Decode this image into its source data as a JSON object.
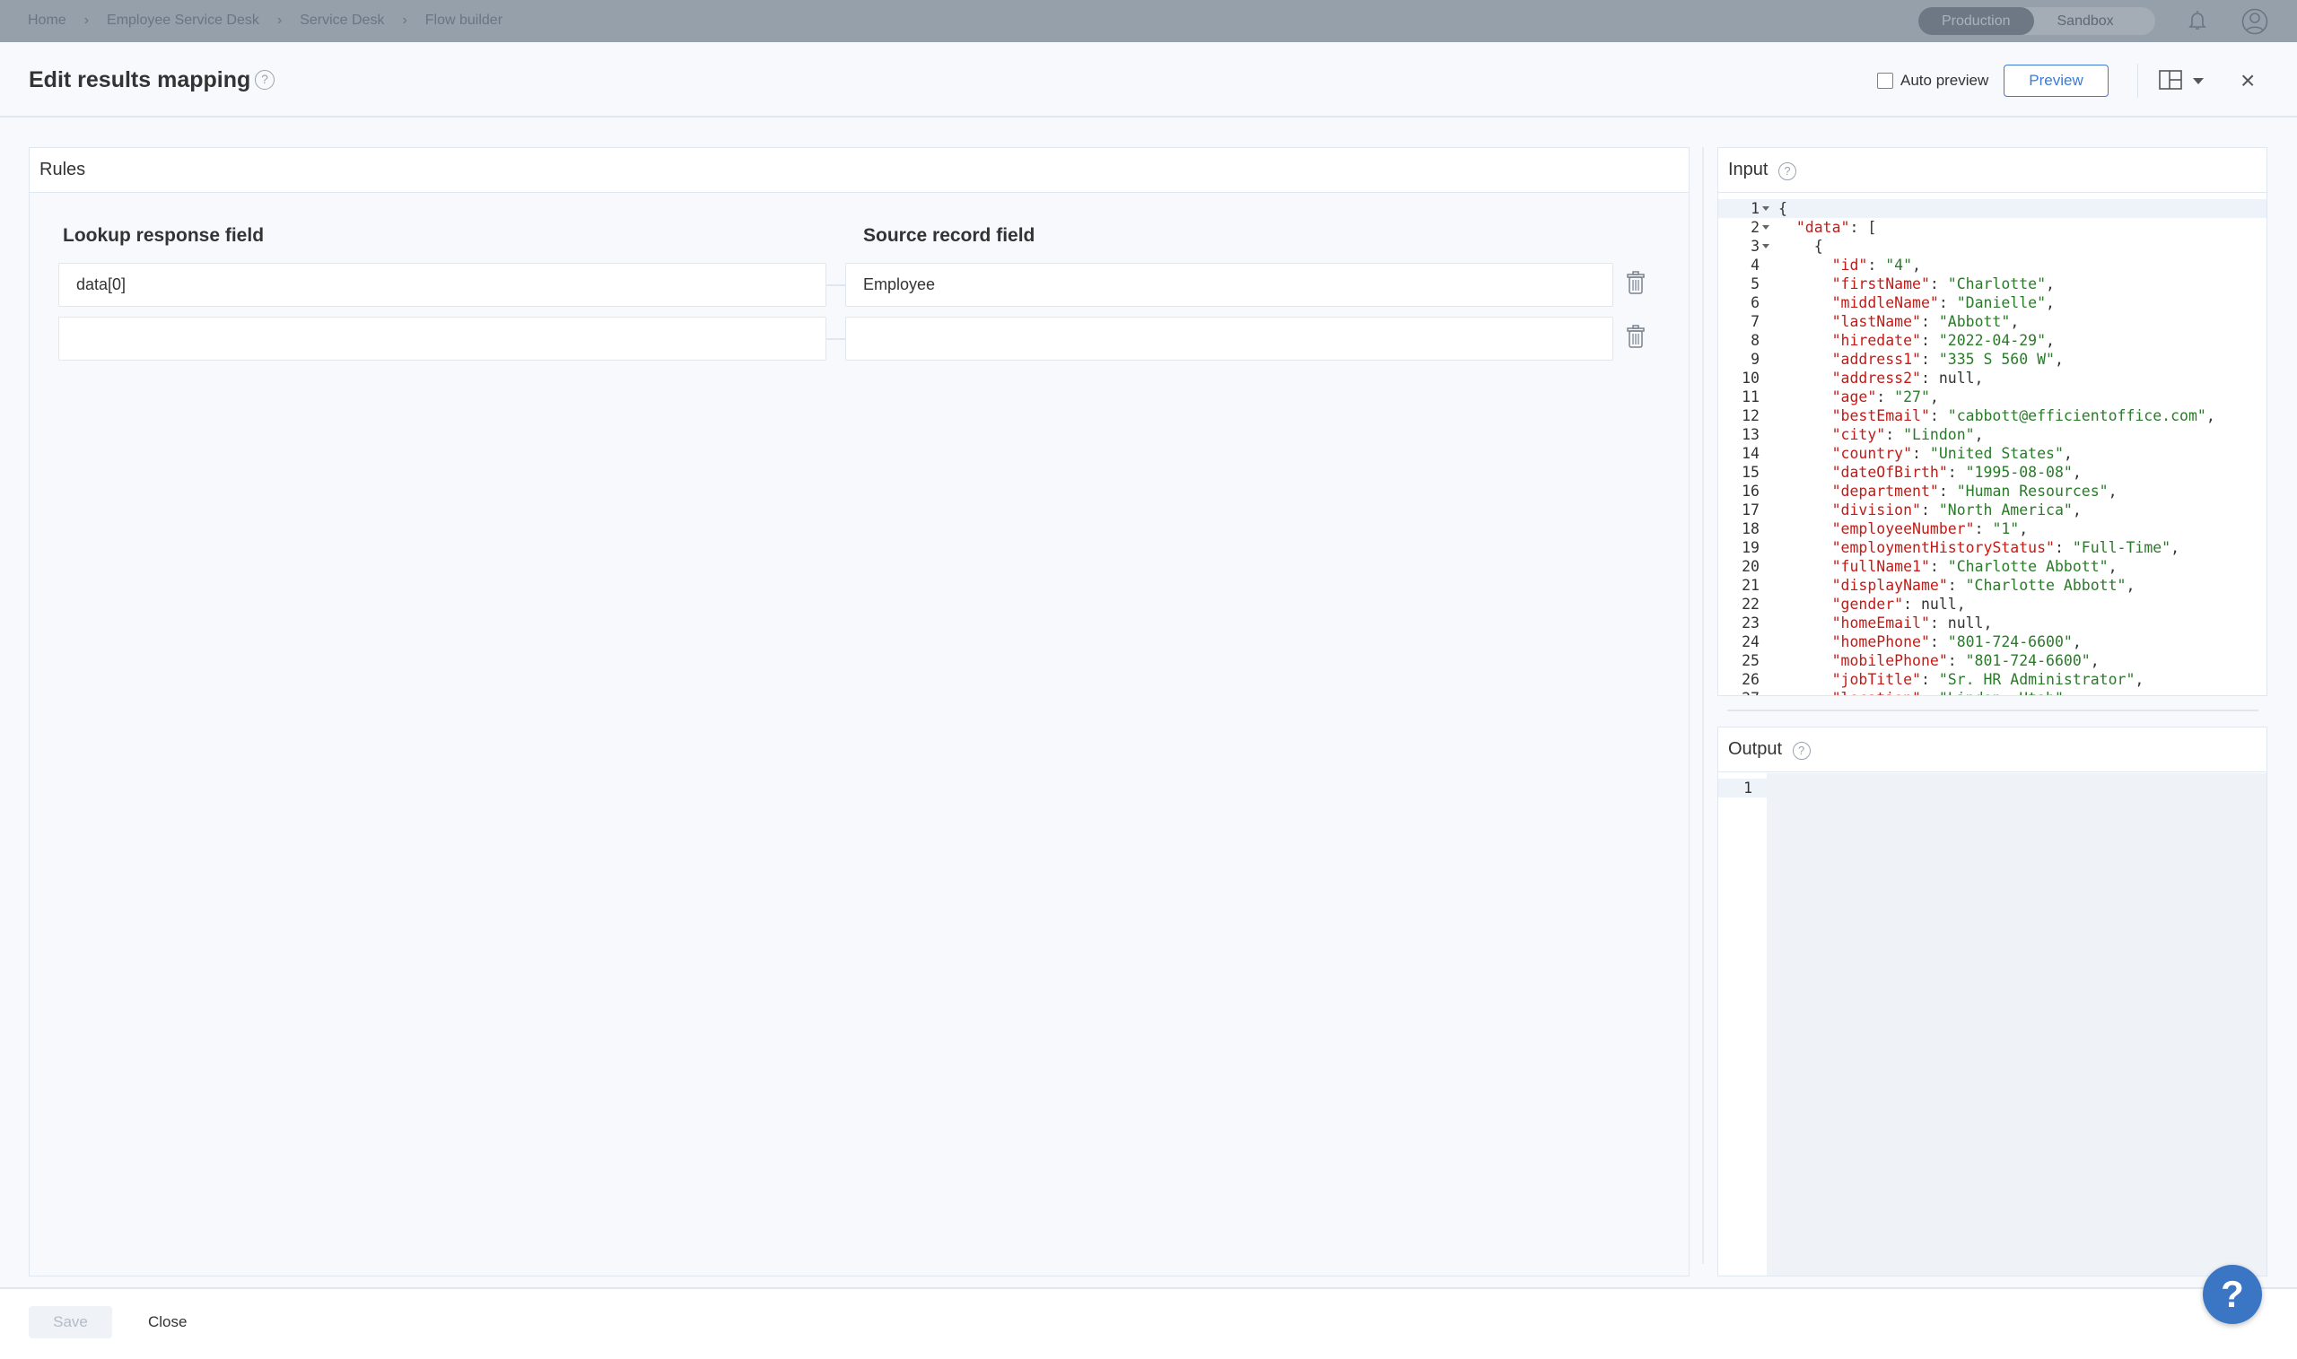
{
  "topbar": {
    "breadcrumbs": [
      "Home",
      "Employee Service Desk",
      "Service Desk",
      "Flow builder"
    ],
    "environments": [
      {
        "label": "Production",
        "active": true
      },
      {
        "label": "Sandbox",
        "active": false
      }
    ]
  },
  "header": {
    "title": "Edit results mapping",
    "help": "?",
    "auto_preview_label": "Auto preview",
    "auto_preview_checked": false,
    "preview_label": "Preview",
    "close": "×"
  },
  "rules": {
    "title": "Rules",
    "col_lookup": "Lookup response field",
    "col_source": "Source record field",
    "rows": [
      {
        "lookup": "data[0]",
        "source": "Employee"
      },
      {
        "lookup": "",
        "source": ""
      }
    ]
  },
  "input": {
    "title": "Input",
    "help": "?",
    "lines": [
      "{",
      "  \"data\": [",
      "    {",
      "      \"id\": \"4\",",
      "      \"firstName\": \"Charlotte\",",
      "      \"middleName\": \"Danielle\",",
      "      \"lastName\": \"Abbott\",",
      "      \"hiredate\": \"2022-04-29\",",
      "      \"address1\": \"335 S 560 W\",",
      "      \"address2\": null,",
      "      \"age\": \"27\",",
      "      \"bestEmail\": \"cabbott@efficientoffice.com\",",
      "      \"city\": \"Lindon\",",
      "      \"country\": \"United States\",",
      "      \"dateOfBirth\": \"1995-08-08\",",
      "      \"department\": \"Human Resources\",",
      "      \"division\": \"North America\",",
      "      \"employeeNumber\": \"1\",",
      "      \"employmentHistoryStatus\": \"Full-Time\",",
      "      \"fullName1\": \"Charlotte Abbott\",",
      "      \"displayName\": \"Charlotte Abbott\",",
      "      \"gender\": null,",
      "      \"homeEmail\": null,",
      "      \"homePhone\": \"801-724-6600\",",
      "      \"mobilePhone\": \"801-724-6600\",",
      "      \"jobTitle\": \"Sr. HR Administrator\",",
      "      \"location\": \"Lindon, Utah\","
    ]
  },
  "output": {
    "title": "Output",
    "help": "?",
    "line_numbers": [
      "1"
    ]
  },
  "footer": {
    "save_label": "Save",
    "close_label": "Close",
    "help_fab": "?"
  }
}
